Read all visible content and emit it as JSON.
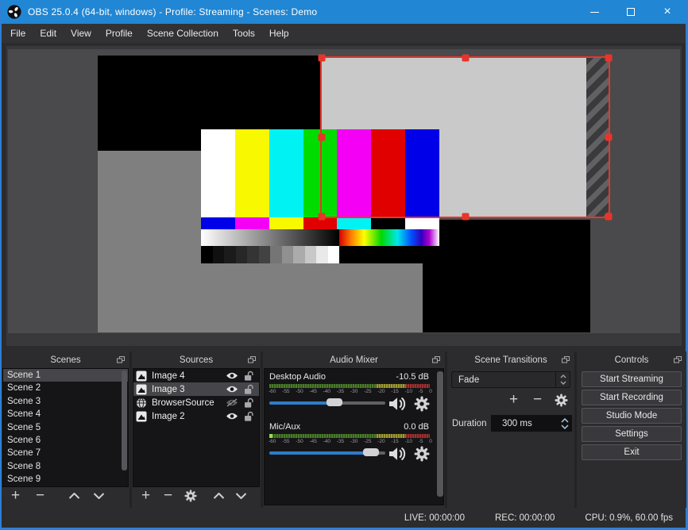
{
  "window": {
    "title": "OBS 25.0.4 (64-bit, windows) - Profile: Streaming - Scenes: Demo"
  },
  "menu": {
    "items": [
      "File",
      "Edit",
      "View",
      "Profile",
      "Scene Collection",
      "Tools",
      "Help"
    ]
  },
  "panels": {
    "scenes": {
      "title": "Scenes",
      "items": [
        "Scene 1",
        "Scene 2",
        "Scene 3",
        "Scene 4",
        "Scene 5",
        "Scene 6",
        "Scene 7",
        "Scene 8",
        "Scene 9"
      ],
      "selected_index": 0
    },
    "sources": {
      "title": "Sources",
      "items": [
        {
          "label": "Image 4",
          "type": "image",
          "visible": true,
          "locked": false,
          "selected": false
        },
        {
          "label": "Image 3",
          "type": "image",
          "visible": true,
          "locked": false,
          "selected": true
        },
        {
          "label": "BrowserSource",
          "type": "browser",
          "visible": false,
          "locked": false,
          "selected": false
        },
        {
          "label": "Image 2",
          "type": "image",
          "visible": true,
          "locked": false,
          "selected": false
        }
      ]
    },
    "audio_mixer": {
      "title": "Audio Mixer",
      "tick_labels": [
        "-60",
        "-55",
        "-50",
        "-45",
        "-40",
        "-35",
        "-30",
        "-25",
        "-20",
        "-15",
        "-10",
        "-5",
        "0"
      ],
      "channels": [
        {
          "name": "Desktop Audio",
          "value": "-10.5 dB",
          "slider_pct": 56,
          "input_active": false
        },
        {
          "name": "Mic/Aux",
          "value": "0.0 dB",
          "slider_pct": 88,
          "input_active": true
        }
      ]
    },
    "scene_transitions": {
      "title": "Scene Transitions",
      "selected_transition": "Fade",
      "duration_label": "Duration",
      "duration_value": "300 ms"
    },
    "controls": {
      "title": "Controls",
      "buttons": [
        "Start Streaming",
        "Start Recording",
        "Studio Mode",
        "Settings",
        "Exit"
      ]
    }
  },
  "statusbar": {
    "live": "LIVE: 00:00:00",
    "rec": "REC: 00:00:00",
    "cpu": "CPU: 0.9%, 60.00 fps"
  },
  "colors": {
    "titlebar_blue": "#2186d3",
    "selection_red": "#e8352a",
    "slider_blue": "#2f7cc7",
    "meter_green": "#4a7c2a",
    "meter_yellow": "#9f9a33",
    "meter_red": "#a03030"
  }
}
